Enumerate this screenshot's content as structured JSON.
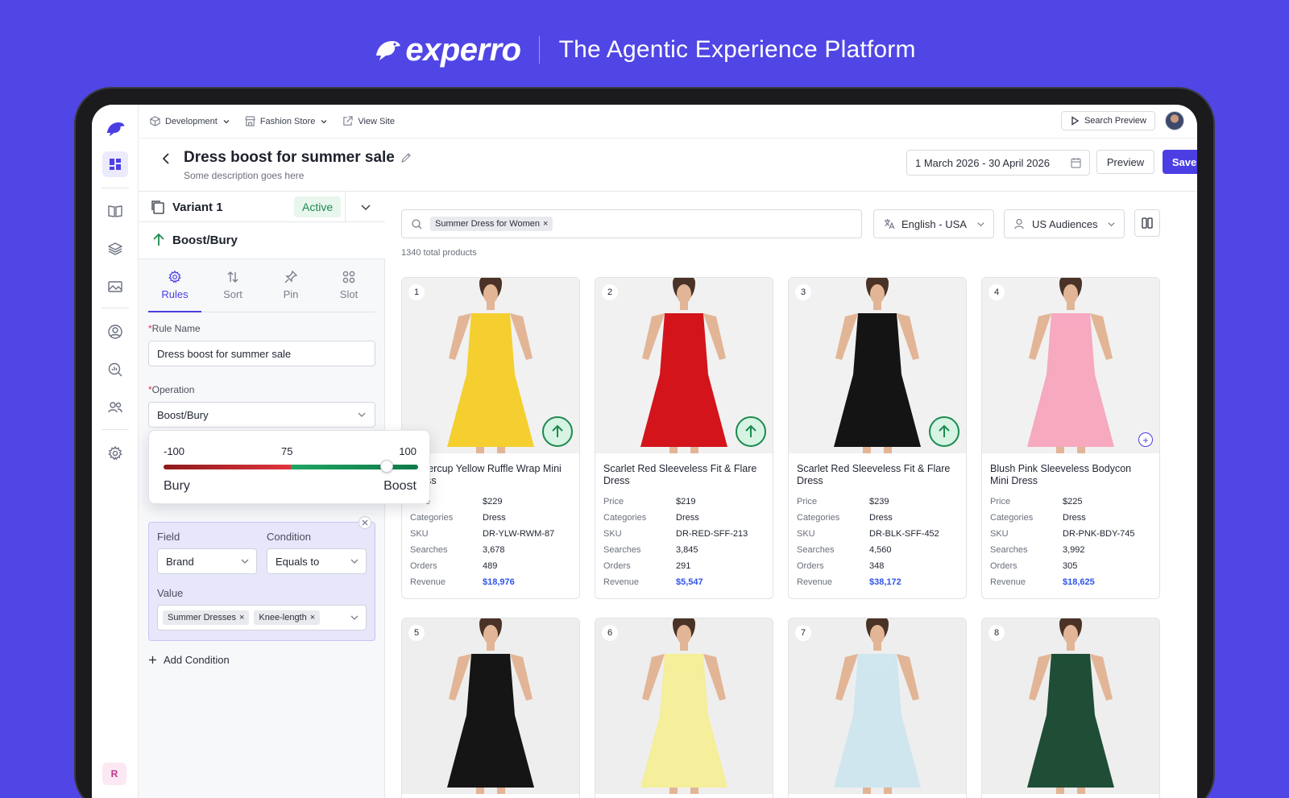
{
  "hero": {
    "brand": "experro",
    "tagline": "The Agentic Experience Platform"
  },
  "topbar": {
    "environment": "Development",
    "store": "Fashion Store",
    "view_site": "View Site",
    "search_preview": "Search Preview"
  },
  "header": {
    "title": "Dress boost for summer sale",
    "description": "Some description goes here",
    "date_range": "1 March 2026 - 30 April 2026",
    "preview_label": "Preview",
    "save_label": "Save"
  },
  "rail": {
    "user_initial": "R"
  },
  "panel": {
    "variant_name": "Variant 1",
    "variant_status": "Active",
    "section_title": "Boost/Bury",
    "tabs": [
      {
        "label": "Rules",
        "icon": "gear-icon",
        "active": true
      },
      {
        "label": "Sort",
        "icon": "sort-icon",
        "active": false
      },
      {
        "label": "Pin",
        "icon": "pin-icon",
        "active": false
      },
      {
        "label": "Slot",
        "icon": "slot-icon",
        "active": false
      }
    ],
    "rule_name_label": "Rule Name",
    "rule_name_value": "Dress boost for summer sale",
    "operation_label": "Operation",
    "operation_value": "Boost/Bury",
    "slider": {
      "min": "-100",
      "value": "75",
      "max": "100",
      "left_label": "Bury",
      "right_label": "Boost",
      "level": 75,
      "range": [
        -100,
        100
      ]
    },
    "condition": {
      "field_label": "Field",
      "field_value": "Brand",
      "condition_label": "Condition",
      "condition_value": "Equals to",
      "value_label": "Value",
      "value_chips": [
        "Summer Dresses",
        "Knee-length"
      ]
    },
    "add_condition": "Add Condition"
  },
  "content": {
    "search_chip": "Summer Dress for Women",
    "language": "English - USA",
    "audience": "US Audiences",
    "total_products": "1340 total products",
    "stat_labels": {
      "price": "Price",
      "categories": "Categories",
      "sku": "SKU",
      "searches": "Searches",
      "orders": "Orders",
      "revenue": "Revenue"
    },
    "products": [
      {
        "num": "1",
        "name": "Buttercup Yellow Ruffle Wrap Mini Dress",
        "price": "$229",
        "categories": "Dress",
        "sku": "DR-YLW-RWM-87",
        "searches": "3,678",
        "orders": "489",
        "revenue": "$18,976",
        "badge": "boost",
        "dress_color": "#f4cf2f",
        "bg": "#f1f1f1"
      },
      {
        "num": "2",
        "name": "Scarlet Red Sleeveless Fit & Flare Dress",
        "price": "$219",
        "categories": "Dress",
        "sku": "DR-RED-SFF-213",
        "searches": "3,845",
        "orders": "291",
        "revenue": "$5,547",
        "badge": "boost",
        "dress_color": "#d4141b",
        "bg": "#f1f1f1"
      },
      {
        "num": "3",
        "name": "Scarlet Red Sleeveless Fit & Flare Dress",
        "price": "$239",
        "categories": "Dress",
        "sku": "DR-BLK-SFF-452",
        "searches": "4,560",
        "orders": "348",
        "revenue": "$38,172",
        "badge": "boost",
        "dress_color": "#141414",
        "bg": "#f1f1f1"
      },
      {
        "num": "4",
        "name": "Blush Pink Sleeveless Bodycon Mini Dress",
        "price": "$225",
        "categories": "Dress",
        "sku": "DR-PNK-BDY-745",
        "searches": "3,992",
        "orders": "305",
        "revenue": "$18,625",
        "badge": "add",
        "dress_color": "#f6a9bf",
        "bg": "#f1f1f1"
      },
      {
        "num": "5",
        "dress_color": "#151515",
        "bg": "#eeeeee"
      },
      {
        "num": "6",
        "dress_color": "#f5ee9a",
        "bg": "#eeeeee"
      },
      {
        "num": "7",
        "dress_color": "#cfe6ef",
        "bg": "#eeeeee"
      },
      {
        "num": "8",
        "dress_color": "#1f4d36",
        "bg": "#eeeeee"
      }
    ]
  },
  "colors": {
    "brand": "#5046e5",
    "primary": "#4b3fe4",
    "success": "#1b8a4d",
    "link": "#2f54eb"
  }
}
